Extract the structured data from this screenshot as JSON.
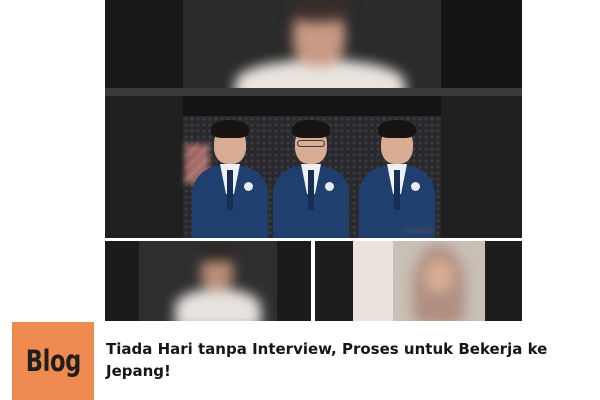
{
  "blog_badge": {
    "label": "Blog",
    "color": "#ef8b50"
  },
  "article": {
    "title": "Tiada Hari tanpa Interview, Proses untuk Bekerja ke Jepang!"
  },
  "video_call": {
    "participants": [
      {
        "role": "interviewer",
        "blurred": true
      },
      {
        "role": "students-group",
        "count": 3,
        "attire": "navy blazer with tie"
      },
      {
        "role": "participant",
        "blurred": true
      },
      {
        "role": "participant",
        "blurred": true
      }
    ]
  },
  "colors": {
    "background": "#ffffff",
    "tile_background": "#1e1e1e",
    "uniform": "#1f3f6e",
    "title_text": "#161616"
  }
}
